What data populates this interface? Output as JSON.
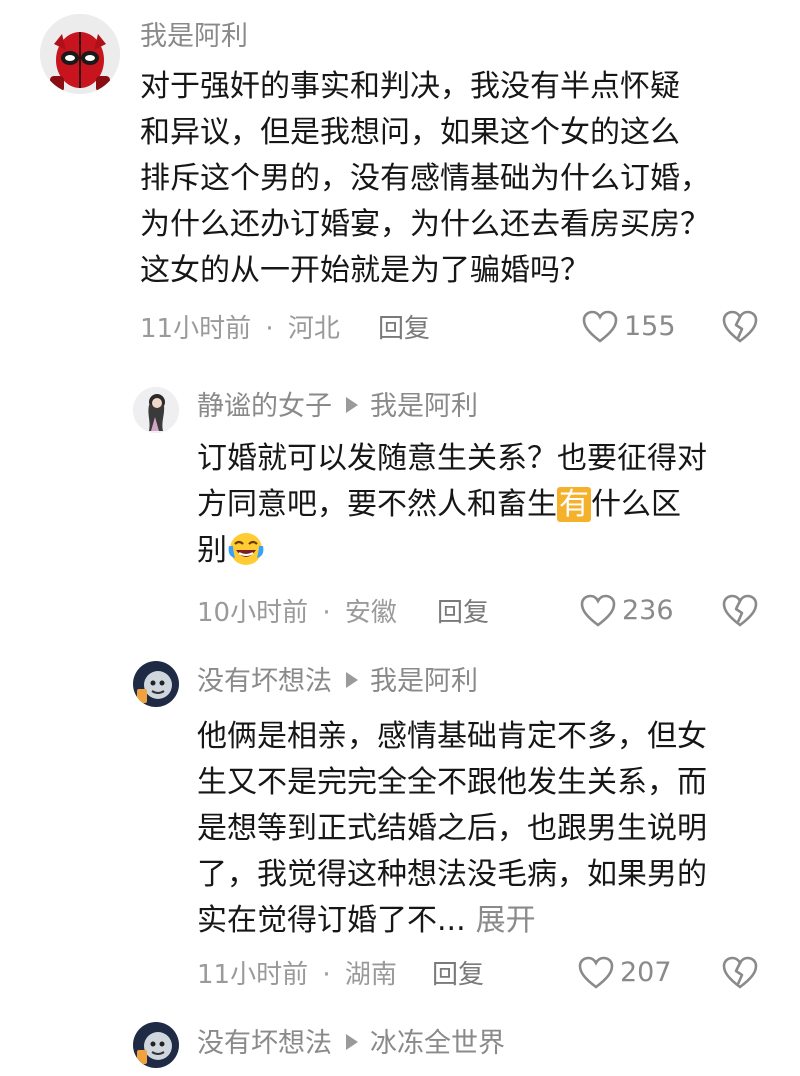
{
  "colors": {
    "text": "#161616",
    "secondary": "#8a8a8a",
    "highlight": "#f5b12b"
  },
  "comments": [
    {
      "user": "我是阿利",
      "lines": [
        "对于强奸的事实和判决，我没有半点怀疑",
        "和异议，但是我想问，如果这个女的这么",
        "排斥这个男的，没有感情基础为什么订婚，",
        "为什么还办订婚宴，为什么还去看房买房？",
        "这女的从一开始就是为了骗婚吗？"
      ],
      "time": "11小时前",
      "location": "河北",
      "reply": "回复",
      "likes": "155",
      "avatar_icon": "deadpool-avatar-icon"
    },
    {
      "user": "静谧的女子",
      "reply_to": "我是阿利",
      "lines": [
        "订婚就可以发随意生关系？也要征得对"
      ],
      "line2_before": "方同意吧，要不然人和畜生",
      "line2_highlight": "有",
      "line2_after": "什么区",
      "line3": "别",
      "emoji_icon": "laughing-crying-emoji-icon",
      "time": "10小时前",
      "location": "安徽",
      "reply": "回复",
      "likes": "236",
      "avatar_icon": "girl-avatar-icon"
    },
    {
      "user": "没有坏想法",
      "reply_to": "我是阿利",
      "lines": [
        "他俩是相亲，感情基础肯定不多，但女",
        "生又不是完完全全不跟他发生关系，而",
        "是想等到正式结婚之后，也跟男生说明",
        "了，我觉得这种想法没毛病，如果男的"
      ],
      "last_line": "实在觉得订婚了不...",
      "expand": "展开",
      "time": "11小时前",
      "location": "湖南",
      "reply": "回复",
      "likes": "207",
      "avatar_icon": "cartoon-avatar-icon"
    },
    {
      "user": "没有坏想法",
      "reply_to": "冰冻全世界",
      "avatar_icon": "cartoon-avatar-icon"
    }
  ],
  "meta_separator": "·"
}
